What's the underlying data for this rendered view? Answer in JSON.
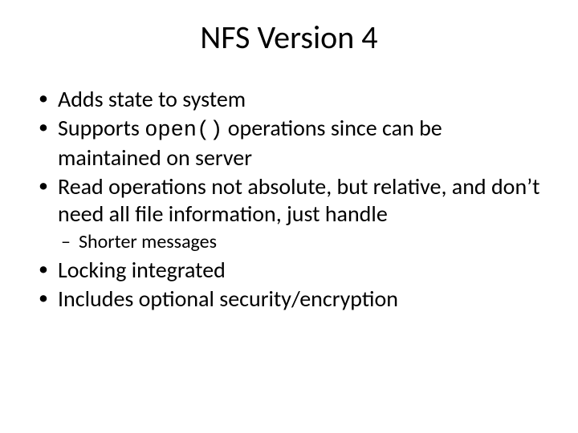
{
  "title": "NFS Version 4",
  "bullets": {
    "b1": "Adds state to system",
    "b2_pre": "Supports ",
    "b2_code": "open()",
    "b2_post": " operations since can be maintained on server",
    "b3": "Read operations not absolute, but relative, and don’t need all file information, just handle",
    "b3_sub1": "Shorter messages",
    "b4": "Locking integrated",
    "b5": "Includes optional security/encryption"
  }
}
